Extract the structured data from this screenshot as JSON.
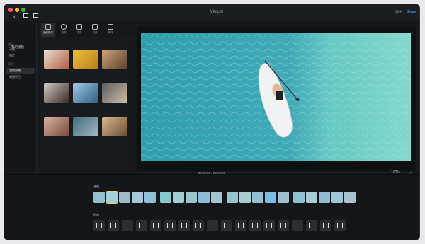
{
  "app": {
    "title": "Vlog.m",
    "export_label": "导出",
    "share_label": "Share"
  },
  "window_controls": {
    "close_color": "#ff5f57",
    "minimize_color": "#febc2e",
    "zoom_color": "#28c840"
  },
  "toolbar_icons": [
    "back-icon",
    "sidebar-toggle-icon",
    "browser-toggle-icon"
  ],
  "sidebar": {
    "section1": "媒体",
    "items1": [
      "动画",
      "照片"
    ],
    "section2": "项目",
    "items2": [
      "我的视频",
      "新建项目"
    ],
    "selected": "我的视频"
  },
  "tabs": [
    {
      "label": "我的媒体",
      "icon": "media-icon",
      "selected": true
    },
    {
      "label": "音频",
      "icon": "audio-icon"
    },
    {
      "label": "字幕",
      "icon": "title-icon"
    },
    {
      "label": "背景",
      "icon": "background-icon"
    },
    {
      "label": "转场",
      "icon": "transition-icon"
    }
  ],
  "media": {
    "title": "我的视频",
    "thumbs": [
      {
        "caption": "",
        "colors": [
          "#e7e1da",
          "#b25d3a"
        ]
      },
      {
        "caption": "",
        "colors": [
          "#f0c23c",
          "#b67e1c"
        ]
      },
      {
        "caption": "",
        "colors": [
          "#cfa676",
          "#5c4130"
        ]
      },
      {
        "caption": "",
        "colors": [
          "#d2cdc8",
          "#3a2520"
        ]
      },
      {
        "caption": "",
        "colors": [
          "#9fc8e6",
          "#2e5f83"
        ]
      },
      {
        "caption": "",
        "colors": [
          "#5b5d61",
          "#cfbca6"
        ]
      },
      {
        "caption": "",
        "colors": [
          "#d5b3a5",
          "#7a4738"
        ]
      },
      {
        "caption": "",
        "colors": [
          "#3e6e7d",
          "#a7b9c0"
        ]
      },
      {
        "caption": "",
        "colors": [
          "#d8b68d",
          "#6c4b35"
        ]
      }
    ]
  },
  "preview": {
    "timecode": "00:00:05 / 00:00:30",
    "zoom_label": "100%",
    "water_color": "#3fa9b8",
    "shallow_color": "#6fd0c3"
  },
  "bottom": {
    "filters_label": "滤镜",
    "effects_label": "特效",
    "filter_groups": [
      {
        "colors": [
          "#93c1cd",
          "#a4cfd5",
          "#9fb9c5",
          "#a7c8d6",
          "#8dbfd6"
        ]
      },
      {
        "colors": [
          "#87c8c9",
          "#a1cdd1",
          "#9bc3cc",
          "#8bbdd5",
          "#a6c5d3"
        ]
      },
      {
        "colors": [
          "#95c6ca",
          "#a9ccd1",
          "#93bed1",
          "#7fbde0",
          "#9fbfcf"
        ]
      },
      {
        "colors": [
          "#8fc0cf",
          "#a8cbd3",
          "#90bccd",
          "#9fc7d8",
          "#a9c3d0"
        ]
      }
    ],
    "effects": [
      "effect-1",
      "effect-2",
      "effect-3",
      "effect-4",
      "effect-5",
      "effect-6",
      "effect-7",
      "effect-8",
      "effect-9",
      "effect-10",
      "effect-11",
      "effect-12",
      "effect-13",
      "effect-14",
      "effect-15",
      "effect-16",
      "effect-17",
      "effect-18"
    ]
  }
}
